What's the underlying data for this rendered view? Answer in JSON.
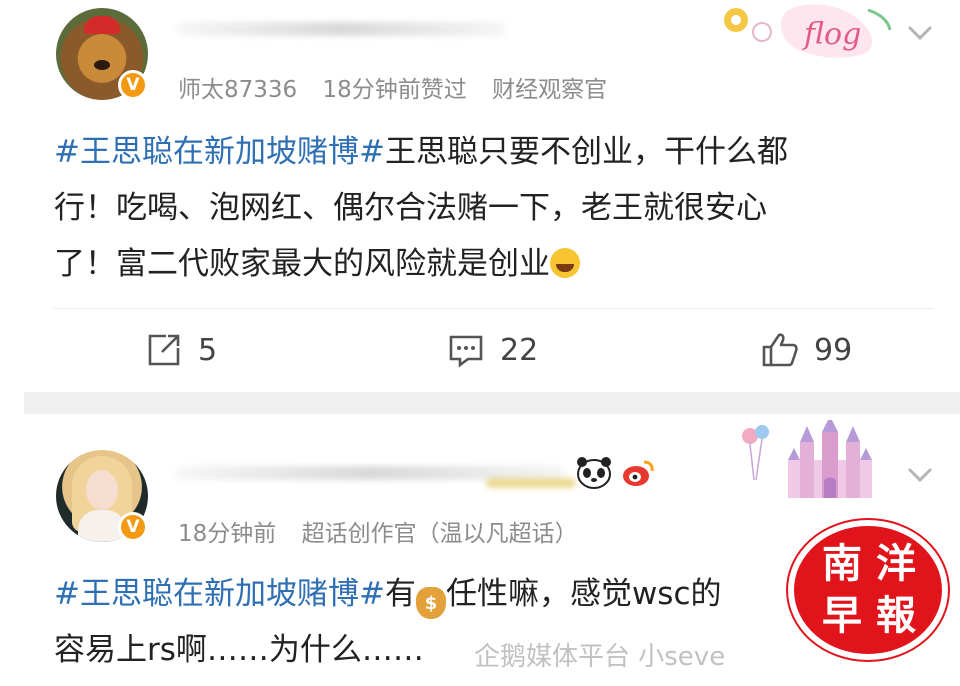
{
  "posts": [
    {
      "meta": {
        "user": "师太87336",
        "time_action": "18分钟前赞过",
        "tag": "财经观察官"
      },
      "badge": "V",
      "lines": [
        {
          "topic": "#王思聪在新加坡赌博#",
          "text": "王思聪只要不创业，干什么都"
        },
        {
          "text": "行！吃喝、泡网红、偶尔合法赌一下，老王就很安心"
        },
        {
          "text": "了！富二代败家最大的风险就是创业"
        }
      ],
      "actions": {
        "share": "5",
        "comment": "22",
        "like": "99"
      },
      "deco_icon": "flog-sticker-icon"
    },
    {
      "meta": {
        "time": "18分钟前",
        "tag": "超话创作官（温以凡超话）"
      },
      "badge": "V",
      "lines": [
        {
          "topic": "#王思聪在新加坡赌博#",
          "before_emoji": "有",
          "after_emoji": "任性嘛，感觉wsc的"
        },
        {
          "text": "容易上rs啊……为什么……"
        }
      ],
      "deco_icon": "castle-sticker-icon"
    }
  ],
  "watermarks": {
    "platform": "企鹅媒体平台 小seve",
    "logo_chars": [
      "南",
      "洋",
      "早",
      "報"
    ]
  },
  "colors": {
    "topic": "#2f6fb3",
    "meta": "#8c8c8c",
    "badge": "#f39a12",
    "logo": "#e1141c"
  }
}
